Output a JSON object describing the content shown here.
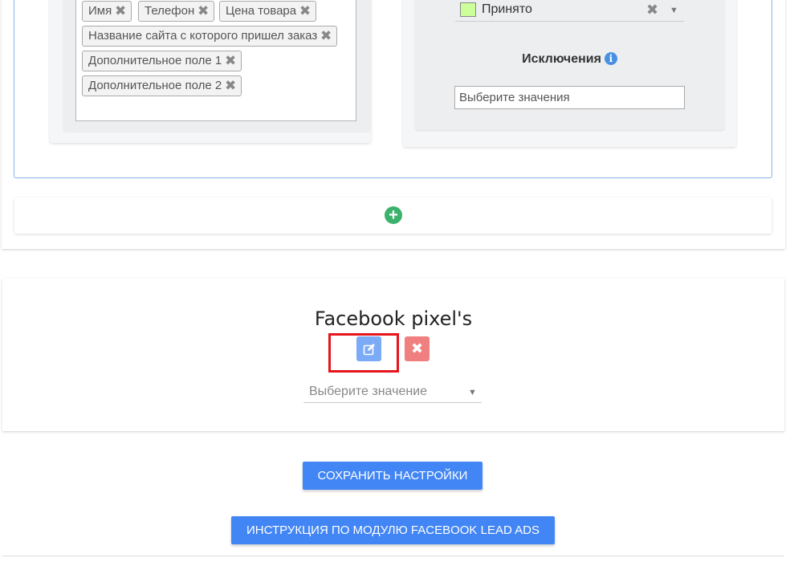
{
  "fields": {
    "tags": [
      {
        "label": "Имя"
      },
      {
        "label": "Телефон"
      },
      {
        "label": "Цена товара"
      },
      {
        "label": "Название сайта с которого пришел заказ"
      },
      {
        "label": "Дополнительное поле 1"
      },
      {
        "label": "Дополнительное поле 2"
      }
    ],
    "remove_glyph": "✖"
  },
  "status": {
    "selected_label": "Принято",
    "swatch_color": "#ccff99",
    "clear_glyph": "✖",
    "caret_glyph": "▼"
  },
  "exclusions": {
    "title": "Исключения",
    "info_glyph": "i",
    "placeholder": "Выберите значения"
  },
  "add_row": {
    "icon": "plus-circle-icon",
    "glyph": "+"
  },
  "pixels": {
    "title": "Facebook pixel's",
    "edit_icon": "edit-icon",
    "delete_glyph": "✖",
    "select_placeholder": "Выберите значение",
    "caret_glyph": "▼"
  },
  "actions": {
    "save_label": "СОХРАНИТЬ НАСТРОЙКИ",
    "instruction_label": "ИНСТРУКЦИЯ ПО МОДУЛЮ FACEBOOK LEAD ADS"
  },
  "colors": {
    "primary_button": "#4285f4",
    "edit_button": "#7baaf7",
    "delete_button": "#f08080",
    "add_icon": "#3bb26b",
    "highlight": "#e5151b"
  }
}
